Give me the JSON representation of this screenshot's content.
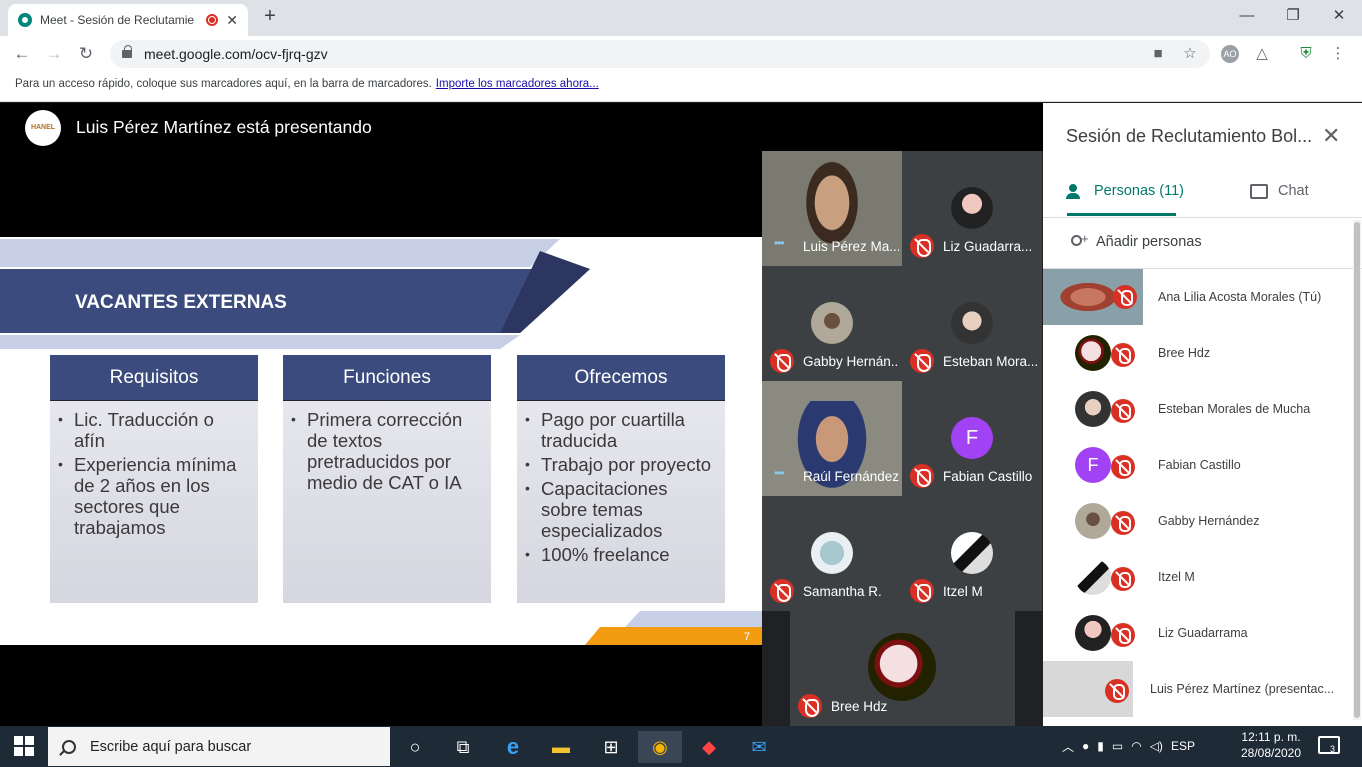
{
  "browser": {
    "tab_title": "Meet - Sesión de Reclutamie",
    "url": "meet.google.com/ocv-fjrq-gzv",
    "bookmarks_hint": "Para un acceso rápido, coloque sus marcadores aquí, en la barra de marcadores.",
    "bookmarks_link": "Importe los marcadores ahora...",
    "profile_initials": "AO"
  },
  "meet": {
    "presenter_banner": "Luis Pérez Martínez está presentando",
    "presenter_logo_text": "HANEL"
  },
  "slide": {
    "title": "VACANTES EXTERNAS",
    "page_number": "7",
    "columns": [
      {
        "header": "Requisitos",
        "items": [
          "Lic. Traducción o afín",
          "Experiencia mínima de 2 años en los sectores que trabajamos"
        ]
      },
      {
        "header": "Funciones",
        "items": [
          "Primera corrección de textos pretraducidos por medio de CAT o IA"
        ]
      },
      {
        "header": "Ofrecemos",
        "items": [
          "Pago por cuartilla traducida",
          "Trabajo por proyecto",
          "Capacitaciones sobre temas especializados",
          "100% freelance"
        ]
      }
    ]
  },
  "tiles": [
    {
      "name": "Luis Pérez Ma...",
      "state": "speaking"
    },
    {
      "name": "Liz Guadarra...",
      "state": "muted"
    },
    {
      "name": "Gabby Hernán...",
      "state": "muted"
    },
    {
      "name": "Esteban Mora...",
      "state": "muted"
    },
    {
      "name": "Raúl Fernández",
      "state": "speaking"
    },
    {
      "name": "Fabian Castillo",
      "state": "muted",
      "initial": "F"
    },
    {
      "name": "Samantha R.",
      "state": "muted"
    },
    {
      "name": "Itzel M",
      "state": "muted"
    },
    {
      "name": "Bree Hdz",
      "state": "muted"
    }
  ],
  "panel": {
    "title": "Sesión de Reclutamiento Bol...",
    "people_tab": "Personas (11)",
    "chat_tab": "Chat",
    "add_people": "Añadir personas",
    "participants": [
      {
        "name": "Ana Lilia Acosta Morales (Tú)"
      },
      {
        "name": "Bree Hdz"
      },
      {
        "name": "Esteban Morales de Mucha"
      },
      {
        "name": "Fabian Castillo",
        "initial": "F"
      },
      {
        "name": "Gabby Hernández"
      },
      {
        "name": "Itzel M"
      },
      {
        "name": "Liz Guadarrama"
      },
      {
        "name": "Luis Pérez Martínez (presentac..."
      }
    ]
  },
  "taskbar": {
    "search_placeholder": "Escribe aquí para buscar",
    "language": "ESP",
    "time": "12:11 p. m.",
    "date": "28/08/2020",
    "notifications": "3"
  },
  "colors": {
    "meet_accent": "#00796b",
    "mute_red": "#d93025",
    "slide_navy": "#3c4b7e",
    "fabian_avatar": "#a142f4"
  }
}
